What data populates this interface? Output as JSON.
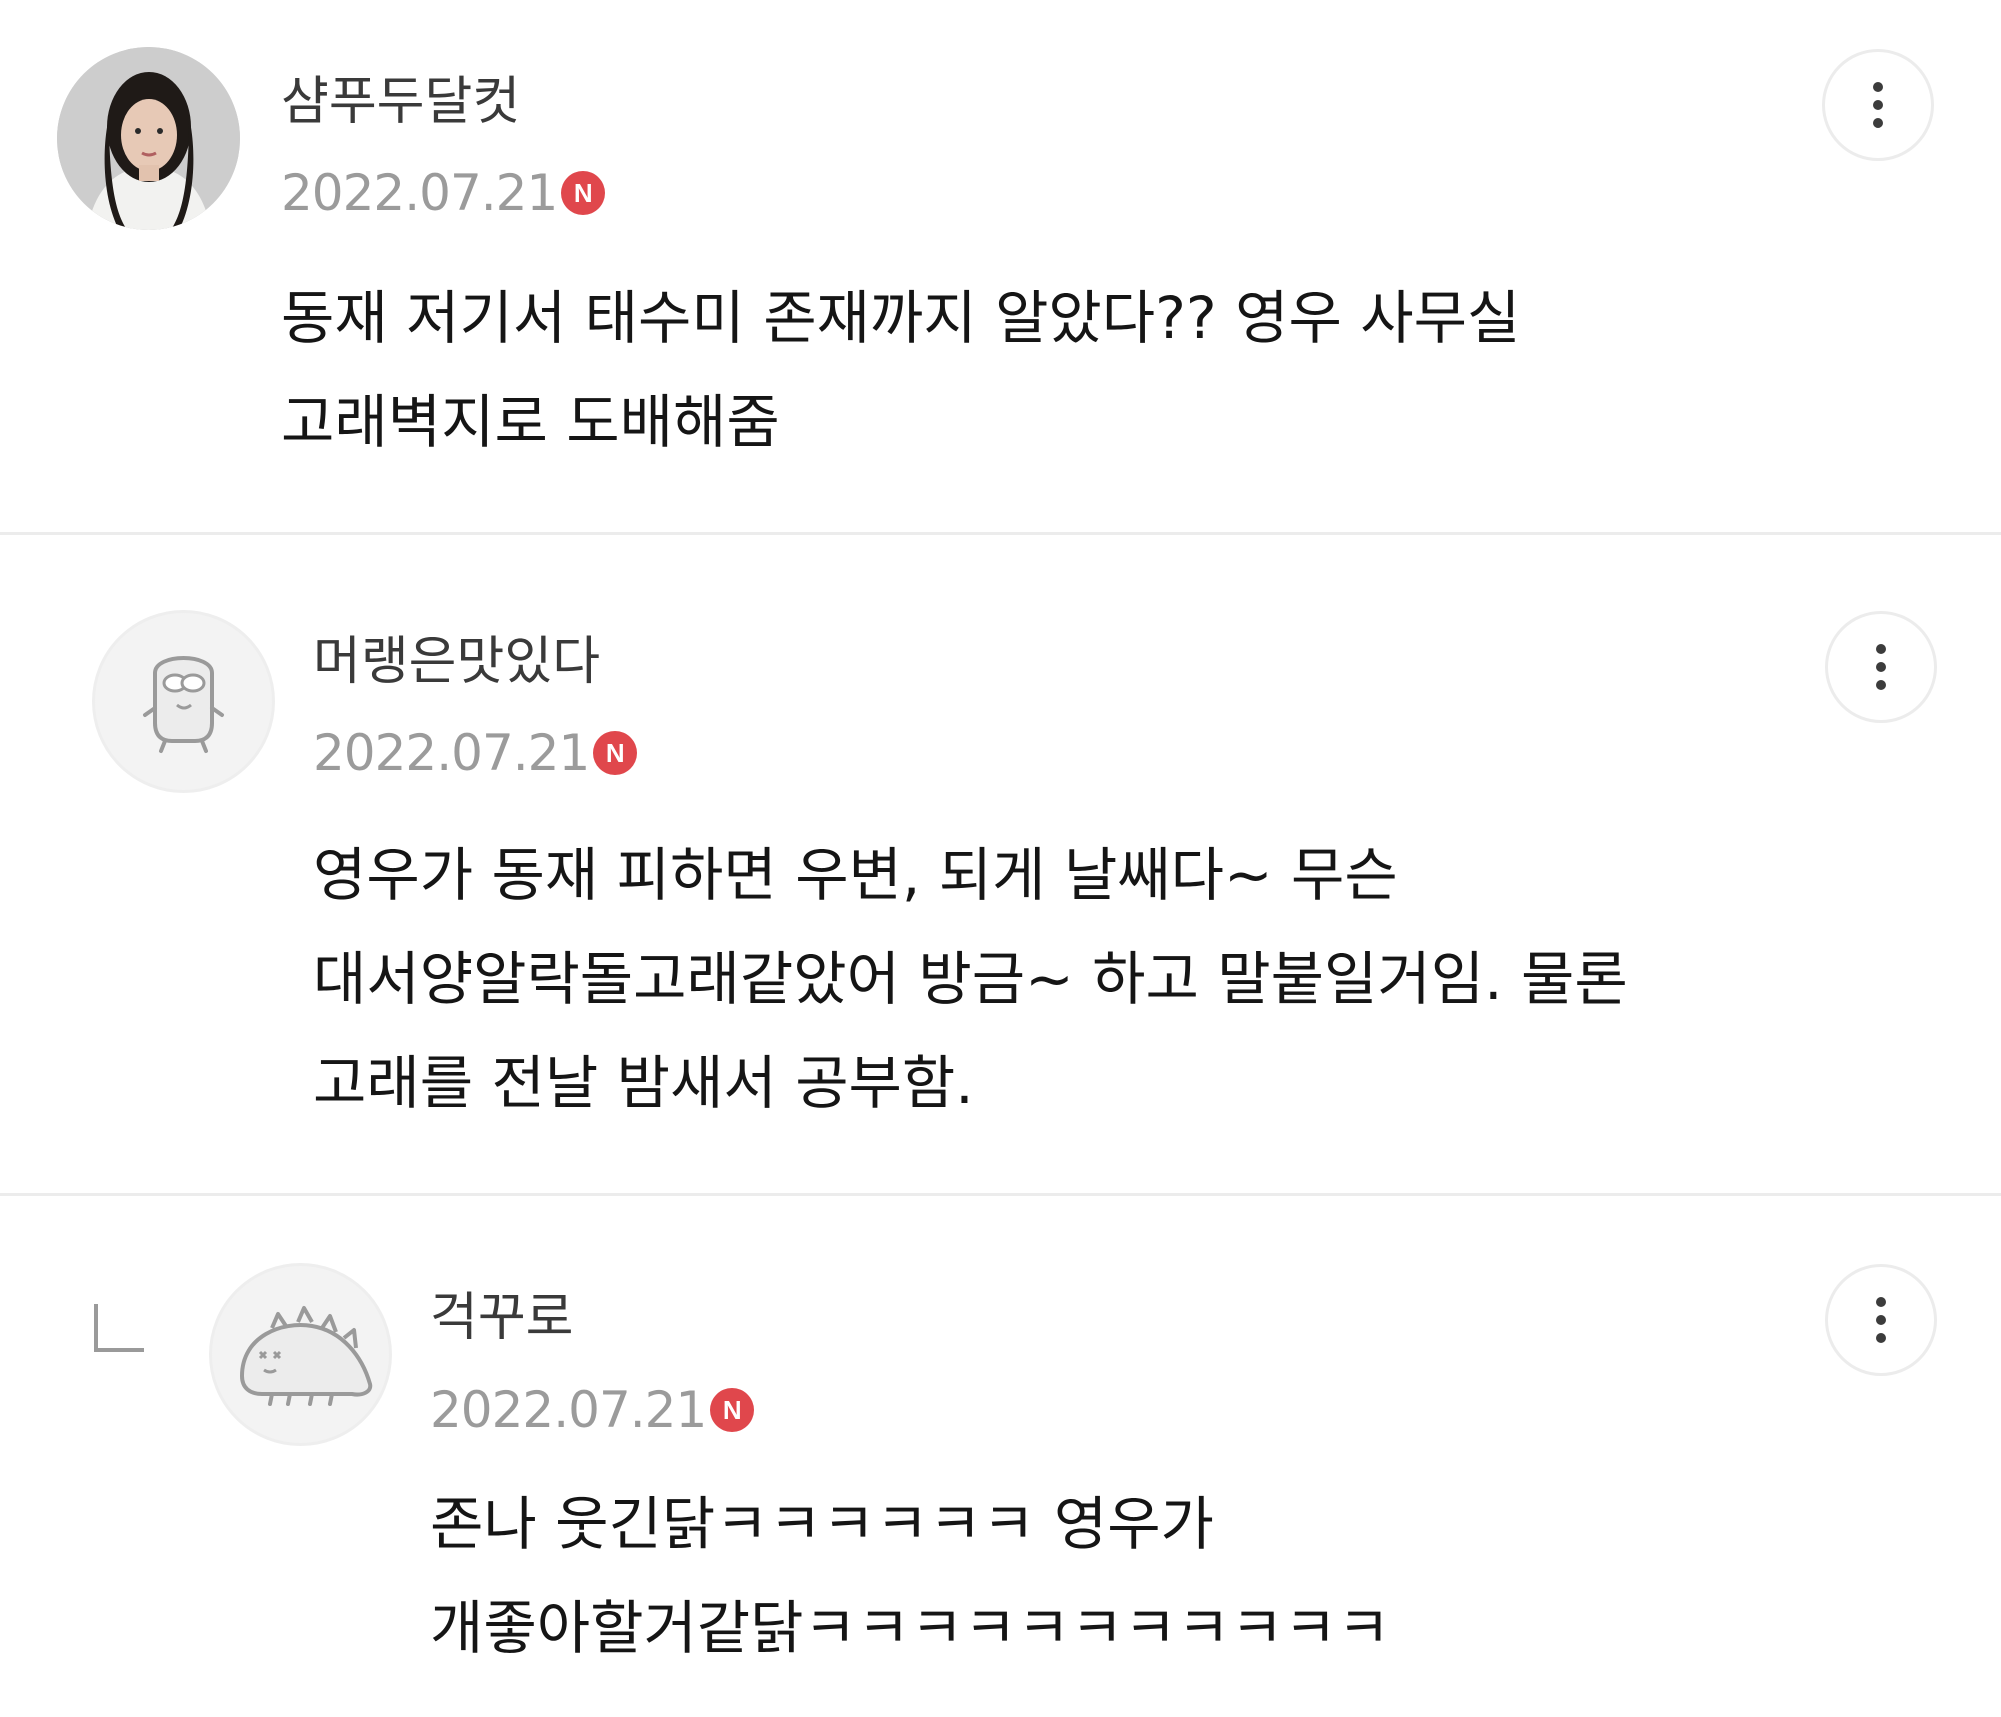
{
  "comments": [
    {
      "nickname": "샴푸두달컷",
      "date": "2022.07.21",
      "new_badge": "N",
      "lines": [
        "동재 저기서 태수미 존재까지 알았다?? 영우 사무실",
        "고래벽지로 도배해줌"
      ],
      "avatar": "profile-photo"
    },
    {
      "nickname": "머랭은맛있다",
      "date": "2022.07.21",
      "new_badge": "N",
      "lines": [
        "영우가 동재 피하면 우변, 되게 날쌔다~ 무슨",
        "대서양알락돌고래같았어 방금~ 하고 말붙일거임. 물론",
        "고래를 전날 밤새서 공부함."
      ],
      "avatar": "default-character"
    },
    {
      "nickname": "걱꾸로",
      "date": "2022.07.21",
      "new_badge": "N",
      "lines": [
        "존나 웃긴닭ㅋㅋㅋㅋㅋㅋ 영우가",
        "개좋아할거같닭ㅋㅋㅋㅋㅋㅋㅋㅋㅋㅋㅋ"
      ],
      "avatar": "default-character",
      "is_reply": true
    }
  ],
  "icons": {
    "more": "kebab-menu-icon",
    "reply": "reply-arrow-icon",
    "new": "new-badge"
  },
  "colors": {
    "new_badge": "#e0474c",
    "date": "#9b9b9b",
    "divider": "#ececec"
  }
}
